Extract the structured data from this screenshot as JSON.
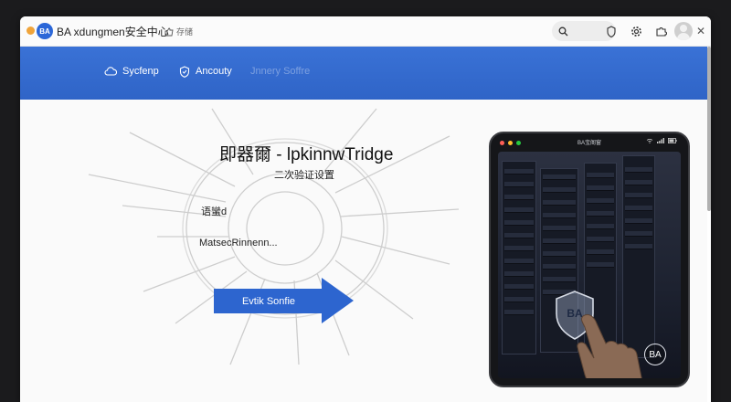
{
  "titlebar": {
    "logo_text": "BA",
    "app_title": "BA xdungmen安全中心",
    "action_label": "存储"
  },
  "nav": {
    "items": [
      {
        "label": "Sycfenp",
        "icon": "cloud-icon"
      },
      {
        "label": "Ancouty",
        "icon": "shield-icon"
      },
      {
        "label": "Jnnery Soffre",
        "icon": ""
      }
    ]
  },
  "main": {
    "title": "即器爾 - lpkinnwTridge",
    "subtitle": "二次验证设置",
    "label1": "语蠻d",
    "label2": "MatsecRinnenn...",
    "cta_label": "Evtik Sonfie"
  },
  "tablet": {
    "title": "BA宝阁窗",
    "shield_text": "BA",
    "badge_text": "BA"
  },
  "colors": {
    "brand_blue": "#2f64c7",
    "nav_blue": "#3a72d6",
    "cta_blue": "#2d65cf"
  }
}
